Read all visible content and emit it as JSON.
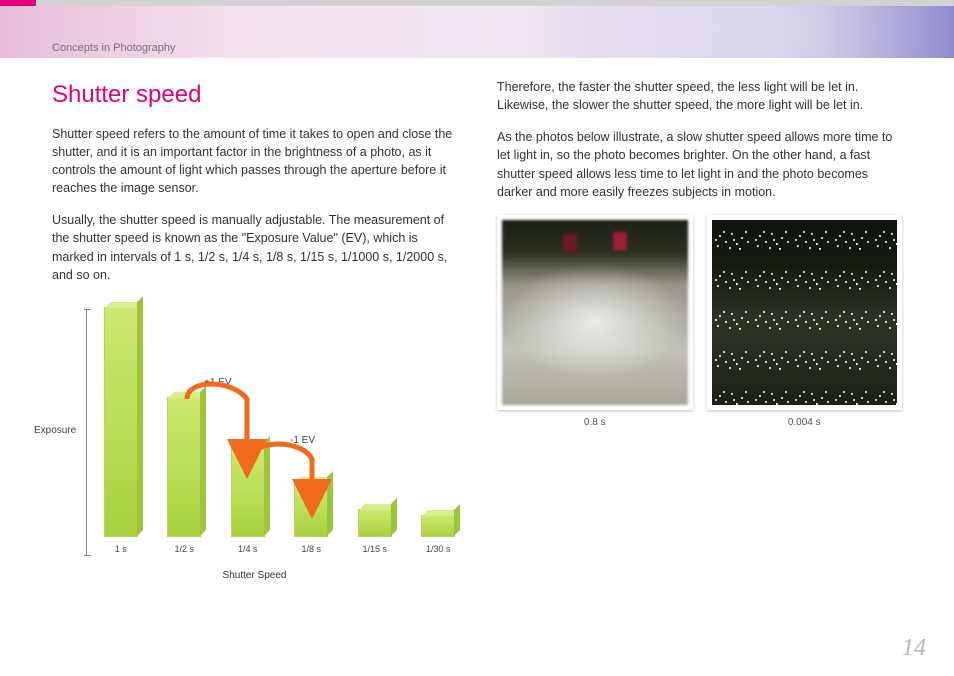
{
  "header": {
    "section_label": "Concepts in Photography"
  },
  "left": {
    "title": "Shutter speed",
    "p1": "Shutter speed refers to the amount of time it takes to open and close the shutter, and it is an important factor in the brightness of a photo, as it controls the amount of light which passes through the aperture before it reaches the image sensor.",
    "p2": "Usually, the shutter speed is manually adjustable. The measurement of the shutter speed is known as the \"Exposure Value\" (EV), which is marked in intervals of 1 s, 1/2 s, 1/4 s, 1/8 s, 1/15 s, 1/1000 s, 1/2000 s, and so on."
  },
  "right": {
    "p1": "Therefore, the faster the shutter speed, the less light will be let in. Likewise, the slower the shutter speed, the more light will be let in.",
    "p2": "As the photos below illustrate, a slow shutter speed allows more time to let light in, so the photo becomes brighter. On the other hand, a fast shutter speed allows less time to let light in and the photo becomes darker and more easily freezes subjects in motion.",
    "photo1_caption": "0.8 s",
    "photo2_caption": "0.004 s"
  },
  "chart_data": {
    "type": "bar",
    "categories": [
      "1 s",
      "1/2 s",
      "1/4 s",
      "1/8 s",
      "1/15 s",
      "1/30 s"
    ],
    "values": [
      230,
      140,
      90,
      55,
      28,
      22
    ],
    "ylabel": "Exposure",
    "xlabel": "Shutter Speed",
    "annotations": {
      "plus1ev": "+1 EV",
      "minus1ev": "-1 EV"
    }
  },
  "page_number": "14"
}
